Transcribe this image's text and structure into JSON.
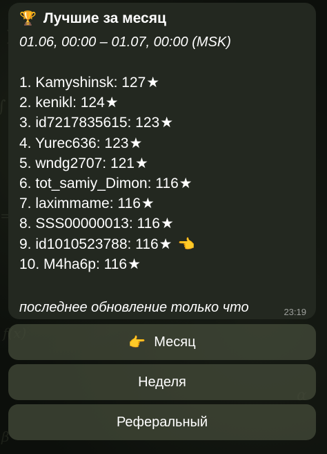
{
  "message": {
    "title": "Лучшие за месяц",
    "trophy_icon": "🏆",
    "period": "01.06, 00:00 – 01.07, 00:00 (MSK)",
    "leaderboard": [
      {
        "rank": "1.",
        "name": "Kamyshinsk",
        "score": "127"
      },
      {
        "rank": "2.",
        "name": "kenikl",
        "score": "124"
      },
      {
        "rank": "3.",
        "name": "id7217835615",
        "score": "123"
      },
      {
        "rank": "4.",
        "name": "Yurec636",
        "score": "123"
      },
      {
        "rank": "5.",
        "name": "wndg2707",
        "score": "121"
      },
      {
        "rank": "6.",
        "name": "tot_samiy_Dimon",
        "score": "116"
      },
      {
        "rank": "7.",
        "name": "laximmame",
        "score": "116"
      },
      {
        "rank": "8.",
        "name": "SSS00000013",
        "score": "116"
      },
      {
        "rank": "9.",
        "name": "id1010523788",
        "score": "116",
        "is_current_user": true
      },
      {
        "rank": "10.",
        "name": "M4ha6p",
        "score": "116"
      }
    ],
    "star_icon": "★",
    "pointer_left_icon": "👈",
    "footer_note": "последнее обновление только что",
    "time": "23:19"
  },
  "keyboard": {
    "month_label": "Месяц",
    "month_icon": "👉",
    "week_label": "Неделя",
    "referral_label": "Реферальный"
  }
}
